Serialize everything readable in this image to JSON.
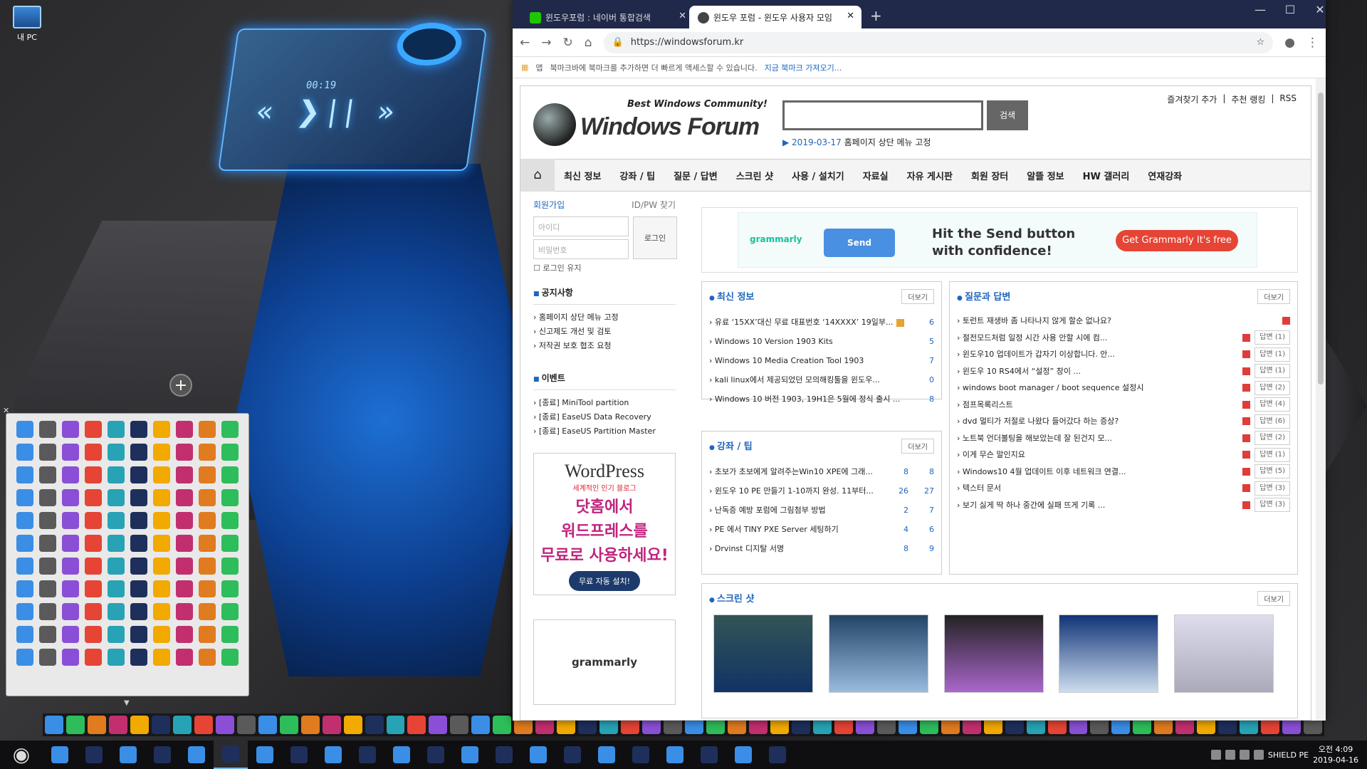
{
  "desktop": {
    "mypc_label": "내 PC",
    "media_time": "00:19",
    "media_controls": "« ❯|| »"
  },
  "browser": {
    "tabs": [
      {
        "title": "윈도우포럼 : 네이버 통합검색",
        "favicon_color": "#1ec800"
      },
      {
        "title": "윈도우 포럼 - 윈도우 사용자 모임",
        "favicon_color": "#444444"
      }
    ],
    "url": "https://windowsforum.kr",
    "bookmark_bar": {
      "apps": "앱",
      "hint": "북마크바에 북마크를 추가하면 더 빠르게 액세스할 수 있습니다.",
      "link": "지금 북마크 가져오기..."
    }
  },
  "site": {
    "tagline": "Best Windows Community!",
    "logo": "Windows Forum",
    "search_btn": "검색",
    "notice_date": "▶ 2019-03-17",
    "notice_text": "홈페이지 상단 메뉴 고정",
    "top_links": [
      "즐겨찾기 추가",
      "추천 랭킹",
      "RSS"
    ],
    "gnb": [
      "최신 정보",
      "강좌 / 팁",
      "질문 / 답변",
      "스크린 샷",
      "사용 / 설치기",
      "자료실",
      "자유 게시판",
      "회원 장터",
      "알뜰 정보",
      "HW 갤러리",
      "연재강좌"
    ],
    "member": {
      "join": "회원가입",
      "find": "ID/PW 찾기",
      "id_ph": "아이디",
      "pw_ph": "비밀번호",
      "login": "로그인",
      "remember": "로그인 유지"
    },
    "notice_box": {
      "title": "공지사항",
      "items": [
        "홈페이지 상단 메뉴 고정",
        "신고제도 개선 및 검토",
        "저작권 보호 협조 요청"
      ]
    },
    "event_box": {
      "title": "이벤트",
      "items": [
        "[종료] MiniTool partition",
        "[종료] EaseUS Data Recovery",
        "[종료] EaseUS Partition Master"
      ]
    },
    "wp_ad": {
      "brand": "WordPress",
      "sub": "세계적인 인기 블로그",
      "big1": "닷홈에서",
      "big2": "워드프레스를",
      "big3": "무료로 사용하세요!",
      "cta": "무료 자동 설치!"
    },
    "gram_small": "grammarly",
    "ad": {
      "brand": "grammarly",
      "send": "Send",
      "headline": "Hit the Send button with confidence!",
      "cta": "Get Grammarly It's free"
    },
    "more_label": "더보기",
    "latest": {
      "title": "최신 정보",
      "rows": [
        {
          "t": "유료 ‘15XX’대신 무료 대표번호 ‘14XXXX’ 19일부...",
          "c": "6"
        },
        {
          "t": "Windows 10 Version 1903 Kits",
          "c": "5"
        },
        {
          "t": "Windows 10 Media Creation Tool 1903",
          "c": "7"
        },
        {
          "t": "kali linux에서 제공되었던 모의해킹툴을 윈도우...",
          "c": "0"
        },
        {
          "t": "Windows 10 버전 1903, 19H1은 5월에 정식 출시 ...",
          "c": "8"
        }
      ]
    },
    "qna": {
      "title": "질문과 답변",
      "rows": [
        {
          "t": "토런트 재생바 좀 나타나지 않게 할순 없나요?",
          "a": ""
        },
        {
          "t": "절전모드처럼 일정 시간 사용 안할 시에 컴...",
          "a": "답변 (1)"
        },
        {
          "t": "윈도우10 업데이트가 갑자기 이상합니다. 안...",
          "a": "답변 (1)"
        },
        {
          "t": "윈도우 10 RS4에서 “설정” 창이 ...",
          "a": "답변 (1)"
        },
        {
          "t": "windows boot manager / boot sequence 설정시",
          "a": "답변 (2)"
        },
        {
          "t": "점프목록리스트",
          "a": "답변 (4)"
        },
        {
          "t": "dvd 멀티가 저절로 나왔다 들어갔다 하는 증상?",
          "a": "답변 (6)"
        },
        {
          "t": "노트북 언더볼팅을 해보았는데 잘 된건지 모...",
          "a": "답변 (2)"
        },
        {
          "t": "이게 무슨 말인지요",
          "a": "답변 (1)"
        },
        {
          "t": "Windows10 4월 업데이트 이후 네트워크 연결...",
          "a": "답변 (5)"
        },
        {
          "t": "텍스터 문서",
          "a": "답변 (3)"
        },
        {
          "t": "보기 싫게 딱 하나 중간에 실패 뜨게 기록 ...",
          "a": "답변 (3)"
        }
      ]
    },
    "tips": {
      "title": "강좌 / 팁",
      "rows": [
        {
          "t": "초보가 초보에게 알려주는Win10 XPE에 그래...",
          "l": "8",
          "c": "8"
        },
        {
          "t": "윈도우 10 PE 만들기 1-10까지 완성. 11부터...",
          "l": "26",
          "c": "27"
        },
        {
          "t": "난독증 예방 포럼에 그림첨부 방법",
          "l": "2",
          "c": "7"
        },
        {
          "t": "PE 에서 TINY PXE Server 세팅하기",
          "l": "4",
          "c": "6"
        },
        {
          "t": "Drvinst 디지탈 서명",
          "l": "8",
          "c": "9"
        }
      ]
    },
    "screens": {
      "title": "스크린 샷"
    }
  },
  "taskbar": {
    "tray_label": "SHIELD PE",
    "time": "오전 4:09",
    "date": "2019-04-16"
  }
}
